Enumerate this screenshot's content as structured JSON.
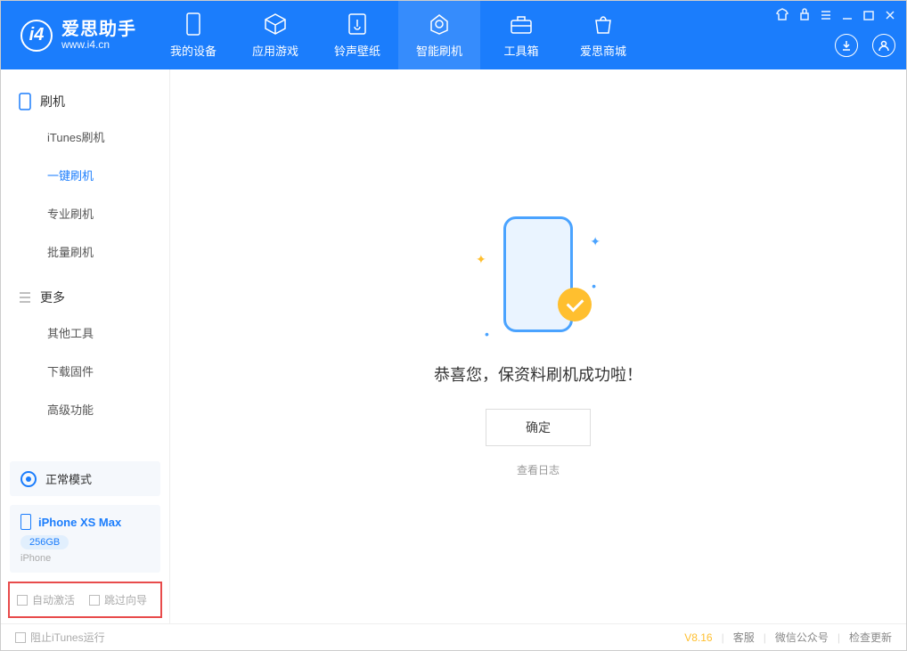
{
  "app": {
    "name": "爱思助手",
    "url": "www.i4.cn"
  },
  "nav": {
    "device": "我的设备",
    "apps": "应用游戏",
    "ringtones": "铃声壁纸",
    "flash": "智能刷机",
    "toolbox": "工具箱",
    "store": "爱思商城"
  },
  "sidebar": {
    "section_flash": "刷机",
    "items_flash": {
      "itunes": "iTunes刷机",
      "onekey": "一键刷机",
      "pro": "专业刷机",
      "batch": "批量刷机"
    },
    "section_more": "更多",
    "items_more": {
      "other": "其他工具",
      "firmware": "下载固件",
      "advanced": "高级功能"
    },
    "status": "正常模式",
    "device": {
      "name": "iPhone XS Max",
      "capacity": "256GB",
      "type": "iPhone"
    },
    "check_auto": "自动激活",
    "check_skip": "跳过向导"
  },
  "main": {
    "success": "恭喜您，保资料刷机成功啦！",
    "ok": "确定",
    "log": "查看日志"
  },
  "footer": {
    "block_itunes": "阻止iTunes运行",
    "version": "V8.16",
    "support": "客服",
    "wechat": "微信公众号",
    "update": "检查更新"
  }
}
